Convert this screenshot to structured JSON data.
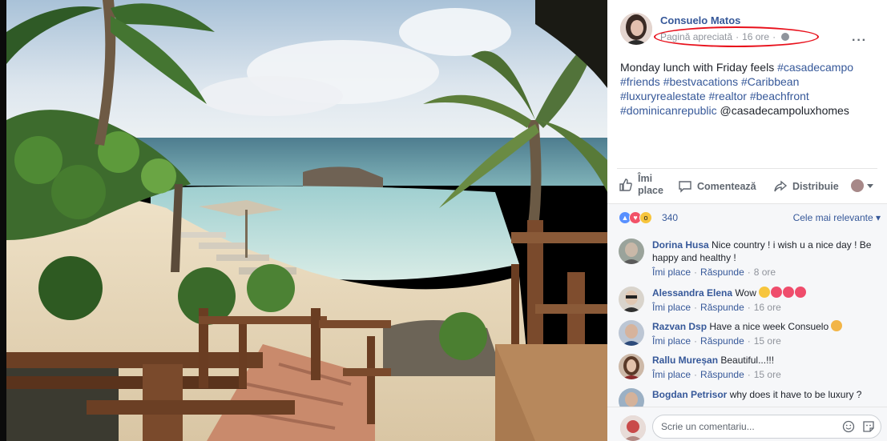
{
  "post": {
    "author": "Consuelo Matos",
    "meta_label": "Pagină apreciată",
    "time": "16 ore",
    "text_plain_1": "Monday lunch with Friday feels ",
    "hashtags_1": "#casadecampo",
    "hashtags_2": "#friends #bestvacations #Caribbean",
    "hashtags_3": "#luxuryrealestate #realtor #beachfront",
    "hashtags_4": "#dominicanrepublic",
    "mention": " @casadecampoluxhomes"
  },
  "actions": {
    "like_label": "Îmi place",
    "comment_label": "Comentează",
    "share_label": "Distribuie"
  },
  "reactions": {
    "count": "340",
    "sort_label": "Cele mai relevante"
  },
  "comments": [
    {
      "name": "Dorina Husa",
      "text": "Nice country ! i wish u a nice day ! Be happy and healthy !",
      "like": "Îmi place",
      "reply": "Răspunde",
      "time": "8 ore"
    },
    {
      "name": "Alessandra Elena",
      "text": "Wow",
      "like": "Îmi place",
      "reply": "Răspunde",
      "time": "16 ore"
    },
    {
      "name": "Razvan Dsp",
      "text": "Have a nice week Consuelo",
      "like": "Îmi place",
      "reply": "Răspunde",
      "time": "15 ore"
    },
    {
      "name": "Rallu Mureșan",
      "text": "Beautiful...!!!",
      "like": "Îmi place",
      "reply": "Răspunde",
      "time": "15 ore"
    },
    {
      "name": "Bogdan Petrisor",
      "text": "why does it have to be luxury ?",
      "like": "",
      "reply": "",
      "time": ""
    }
  ],
  "compose": {
    "placeholder": "Scrie un comentariu..."
  },
  "colors": {
    "link": "#365899",
    "highlight_ellipse": "#e8101b",
    "muted": "#90949c"
  }
}
